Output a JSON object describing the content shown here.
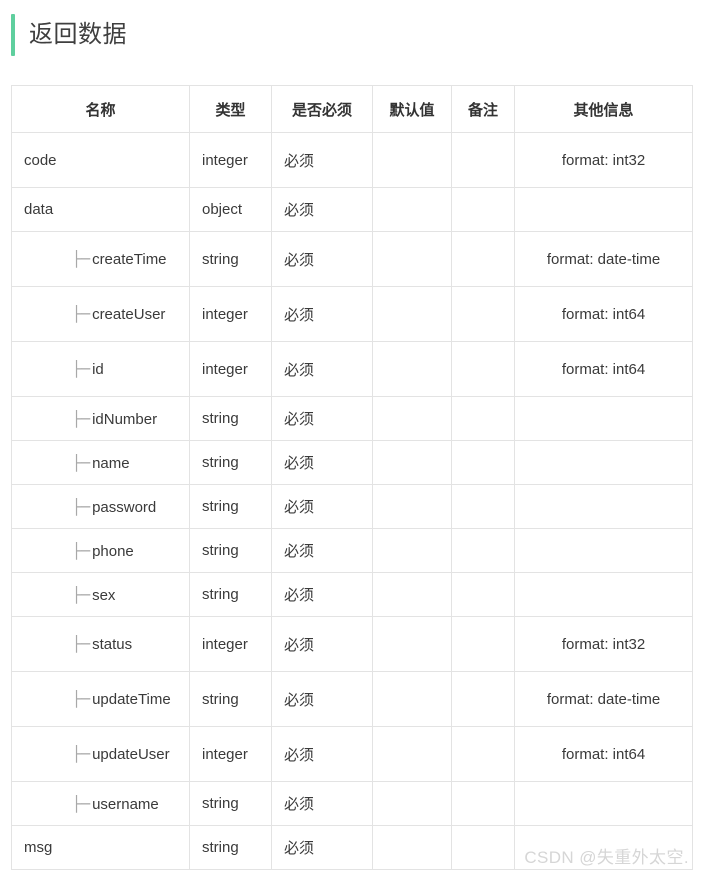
{
  "section": {
    "title": "返回数据",
    "accent_color": "#5fcf9e"
  },
  "table": {
    "headers": {
      "name": "名称",
      "type": "类型",
      "required": "是否必须",
      "default": "默认值",
      "remark": "备注",
      "other": "其他信息"
    },
    "tree_glyph": "├─",
    "rows": [
      {
        "name": "code",
        "type": "integer",
        "required": "必须",
        "default": "",
        "remark": "",
        "other": "format: int32",
        "nested": false
      },
      {
        "name": "data",
        "type": "object",
        "required": "必须",
        "default": "",
        "remark": "",
        "other": "",
        "nested": false
      },
      {
        "name": "createTime",
        "type": "string",
        "required": "必须",
        "default": "",
        "remark": "",
        "other": "format: date-time",
        "nested": true
      },
      {
        "name": "createUser",
        "type": "integer",
        "required": "必须",
        "default": "",
        "remark": "",
        "other": "format: int64",
        "nested": true
      },
      {
        "name": "id",
        "type": "integer",
        "required": "必须",
        "default": "",
        "remark": "",
        "other": "format: int64",
        "nested": true
      },
      {
        "name": "idNumber",
        "type": "string",
        "required": "必须",
        "default": "",
        "remark": "",
        "other": "",
        "nested": true
      },
      {
        "name": "name",
        "type": "string",
        "required": "必须",
        "default": "",
        "remark": "",
        "other": "",
        "nested": true
      },
      {
        "name": "password",
        "type": "string",
        "required": "必须",
        "default": "",
        "remark": "",
        "other": "",
        "nested": true
      },
      {
        "name": "phone",
        "type": "string",
        "required": "必须",
        "default": "",
        "remark": "",
        "other": "",
        "nested": true
      },
      {
        "name": "sex",
        "type": "string",
        "required": "必须",
        "default": "",
        "remark": "",
        "other": "",
        "nested": true
      },
      {
        "name": "status",
        "type": "integer",
        "required": "必须",
        "default": "",
        "remark": "",
        "other": "format: int32",
        "nested": true
      },
      {
        "name": "updateTime",
        "type": "string",
        "required": "必须",
        "default": "",
        "remark": "",
        "other": "format: date-time",
        "nested": true
      },
      {
        "name": "updateUser",
        "type": "integer",
        "required": "必须",
        "default": "",
        "remark": "",
        "other": "format: int64",
        "nested": true
      },
      {
        "name": "username",
        "type": "string",
        "required": "必须",
        "default": "",
        "remark": "",
        "other": "",
        "nested": true
      },
      {
        "name": "msg",
        "type": "string",
        "required": "必须",
        "default": "",
        "remark": "",
        "other": "",
        "nested": false
      }
    ]
  },
  "watermark": {
    "text": "CSDN @失重外太空."
  }
}
